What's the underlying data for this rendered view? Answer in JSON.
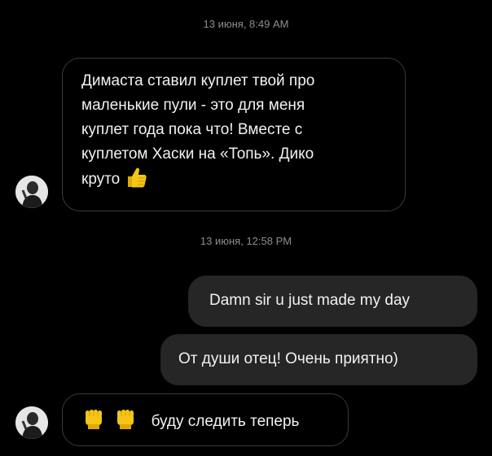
{
  "timestamps": {
    "first": "13 июня, 8:49 AM",
    "second": "13 июня, 12:58 PM"
  },
  "messages": {
    "incoming_1": {
      "lines": [
        "Димаста ставил куплет твой про",
        "маленькие пули - это для меня",
        "куплет года пока что! Вместе с",
        "куплетом Хаски на «Топь». Дико",
        "круто"
      ],
      "emoji": "thumbs-up"
    },
    "outgoing_1": {
      "text": "Damn sir u just made my day"
    },
    "outgoing_2": {
      "text": "От души отец! Очень приятно)"
    },
    "incoming_2": {
      "emoji": [
        "raised-fist",
        "raised-fist"
      ],
      "text": "буду следить теперь"
    }
  },
  "colors": {
    "background": "#000000",
    "outgoing_bubble": "#262626",
    "incoming_border": "#3a3a3a",
    "timestamp": "#8e8e8e",
    "text": "#f2f2f2",
    "emoji_yellow": "#f5c518"
  },
  "icons": {
    "avatar": "profile-photo-avatar",
    "thumbs_up": "thumbs-up-icon",
    "fist": "raised-fist-icon"
  }
}
